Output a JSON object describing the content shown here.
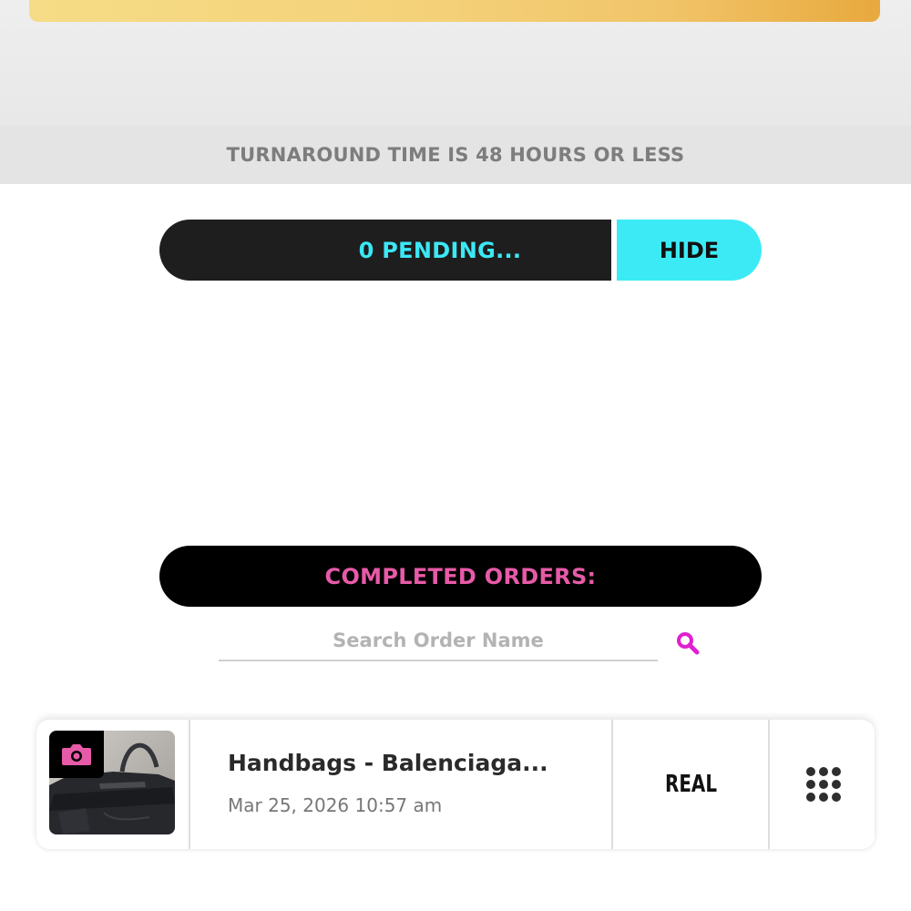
{
  "banner": {
    "turnaround_text": "TURNAROUND TIME IS 48 HOURS OR LESS"
  },
  "pending": {
    "label": "0 PENDING...",
    "hide_label": "HIDE",
    "count": 0
  },
  "completed": {
    "label": "COMPLETED ORDERS:"
  },
  "search": {
    "placeholder": "Search Order Name",
    "value": ""
  },
  "orders": [
    {
      "title": "Handbags - Balenciaga...",
      "date": "Mar 25, 2026 10:57 am",
      "result": "REAL"
    }
  ],
  "colors": {
    "pending_accent": "#3be8f5",
    "completed_accent": "#e75aa8",
    "search_icon": "#e020d0",
    "gold_banner": "#f4d27a"
  },
  "icons": {
    "camera": "camera-icon",
    "search": "search-icon",
    "menu": "grid-dots-icon"
  }
}
